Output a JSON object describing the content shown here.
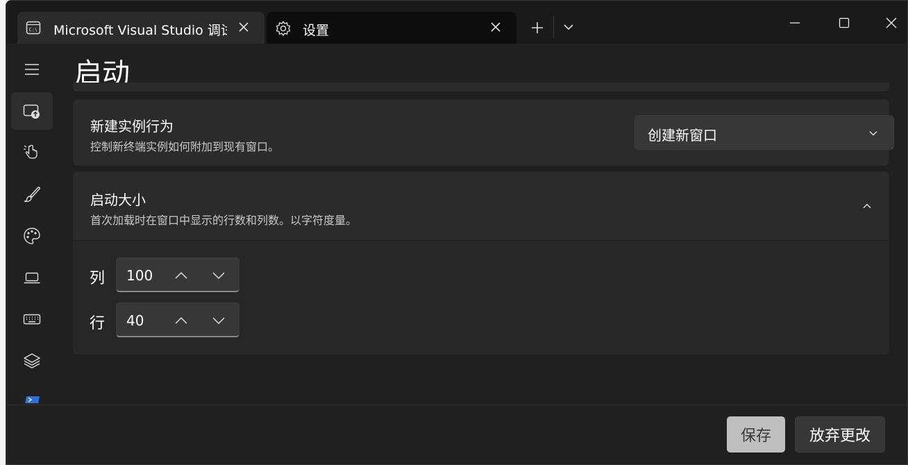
{
  "tabs": [
    {
      "title": "Microsoft Visual Studio 调试",
      "icon": "terminal-icon"
    },
    {
      "title": "设置",
      "icon": "gear-icon"
    }
  ],
  "page": {
    "title": "启动"
  },
  "new_instance": {
    "title": "新建实例行为",
    "description": "控制新终端实例如何附加到现有窗口。",
    "selected": "创建新窗口"
  },
  "launch_size": {
    "title": "启动大小",
    "description": "首次加载时在窗口中显示的行数和列数。以字符度量。",
    "columns_label": "列",
    "columns_value": "100",
    "rows_label": "行",
    "rows_value": "40"
  },
  "footer": {
    "save": "保存",
    "discard": "放弃更改"
  },
  "colors": {
    "background": "#202020",
    "card": "#2b2b2b",
    "save_button": "#bfbfbf"
  }
}
